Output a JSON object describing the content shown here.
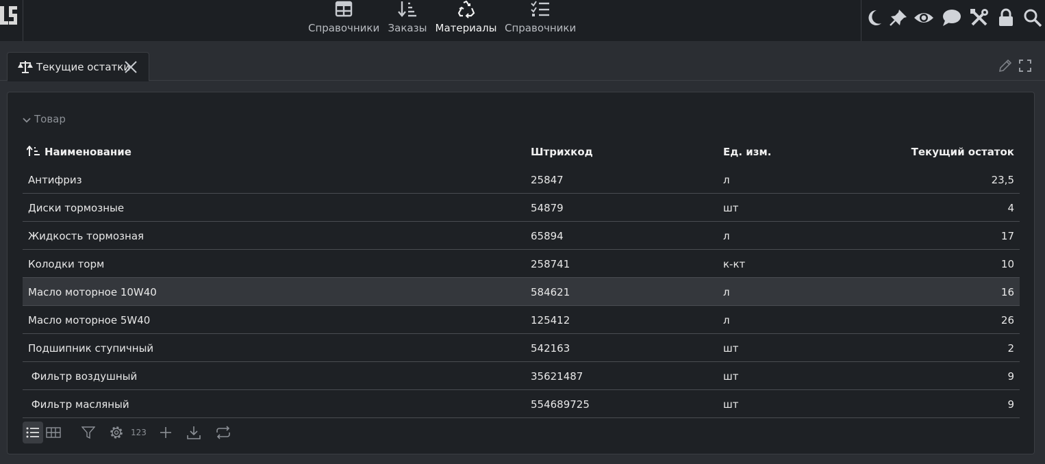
{
  "nav": {
    "items": [
      {
        "label": "Справочники",
        "icon": "table-icon"
      },
      {
        "label": "Заказы",
        "icon": "sort-list-icon"
      },
      {
        "label": "Материалы",
        "icon": "recycle-icon",
        "active": true
      },
      {
        "label": "Справочники",
        "icon": "checklist-icon"
      }
    ]
  },
  "tools": [
    "moon-icon",
    "pin-icon",
    "eye-icon",
    "chat-icon",
    "tools-icon",
    "lock-icon",
    "search-icon"
  ],
  "tab": {
    "label": "Текущие остатки",
    "icon": "scales-icon"
  },
  "group": {
    "label": "Товар"
  },
  "table": {
    "columns": [
      "Наименование",
      "Штрихкод",
      "Ед. изм.",
      "Текущий остаток"
    ],
    "rows": [
      {
        "name": "Антифриз",
        "barcode": "25847",
        "unit": "л",
        "stock": "23,5"
      },
      {
        "name": "Диски тормозные",
        "barcode": "54879",
        "unit": "шт",
        "stock": "4"
      },
      {
        "name": "Жидкость тормозная",
        "barcode": "65894",
        "unit": "л",
        "stock": "17"
      },
      {
        "name": "Колодки торм",
        "barcode": "258741",
        "unit": "к-кт",
        "stock": "10"
      },
      {
        "name": "Масло моторное 10W40",
        "barcode": "584621",
        "unit": "л",
        "stock": "16"
      },
      {
        "name": "Масло моторное 5W40",
        "barcode": "125412",
        "unit": "л",
        "stock": "26"
      },
      {
        "name": "Подшипник ступичный",
        "barcode": "542163",
        "unit": "шт",
        "stock": "2"
      },
      {
        "name": " Фильтр воздушный",
        "barcode": "35621487",
        "unit": "шт",
        "stock": "9"
      },
      {
        "name": " Фильтр масляный",
        "barcode": "554689725",
        "unit": "шт",
        "stock": "9"
      }
    ],
    "highlighted_row": 4
  },
  "toolbar": {
    "count_label": "123"
  },
  "colors": {
    "bg": "#2b2e33",
    "topbar": "#1c1f23",
    "panel": "#1e2125",
    "highlight": "#34373c"
  }
}
